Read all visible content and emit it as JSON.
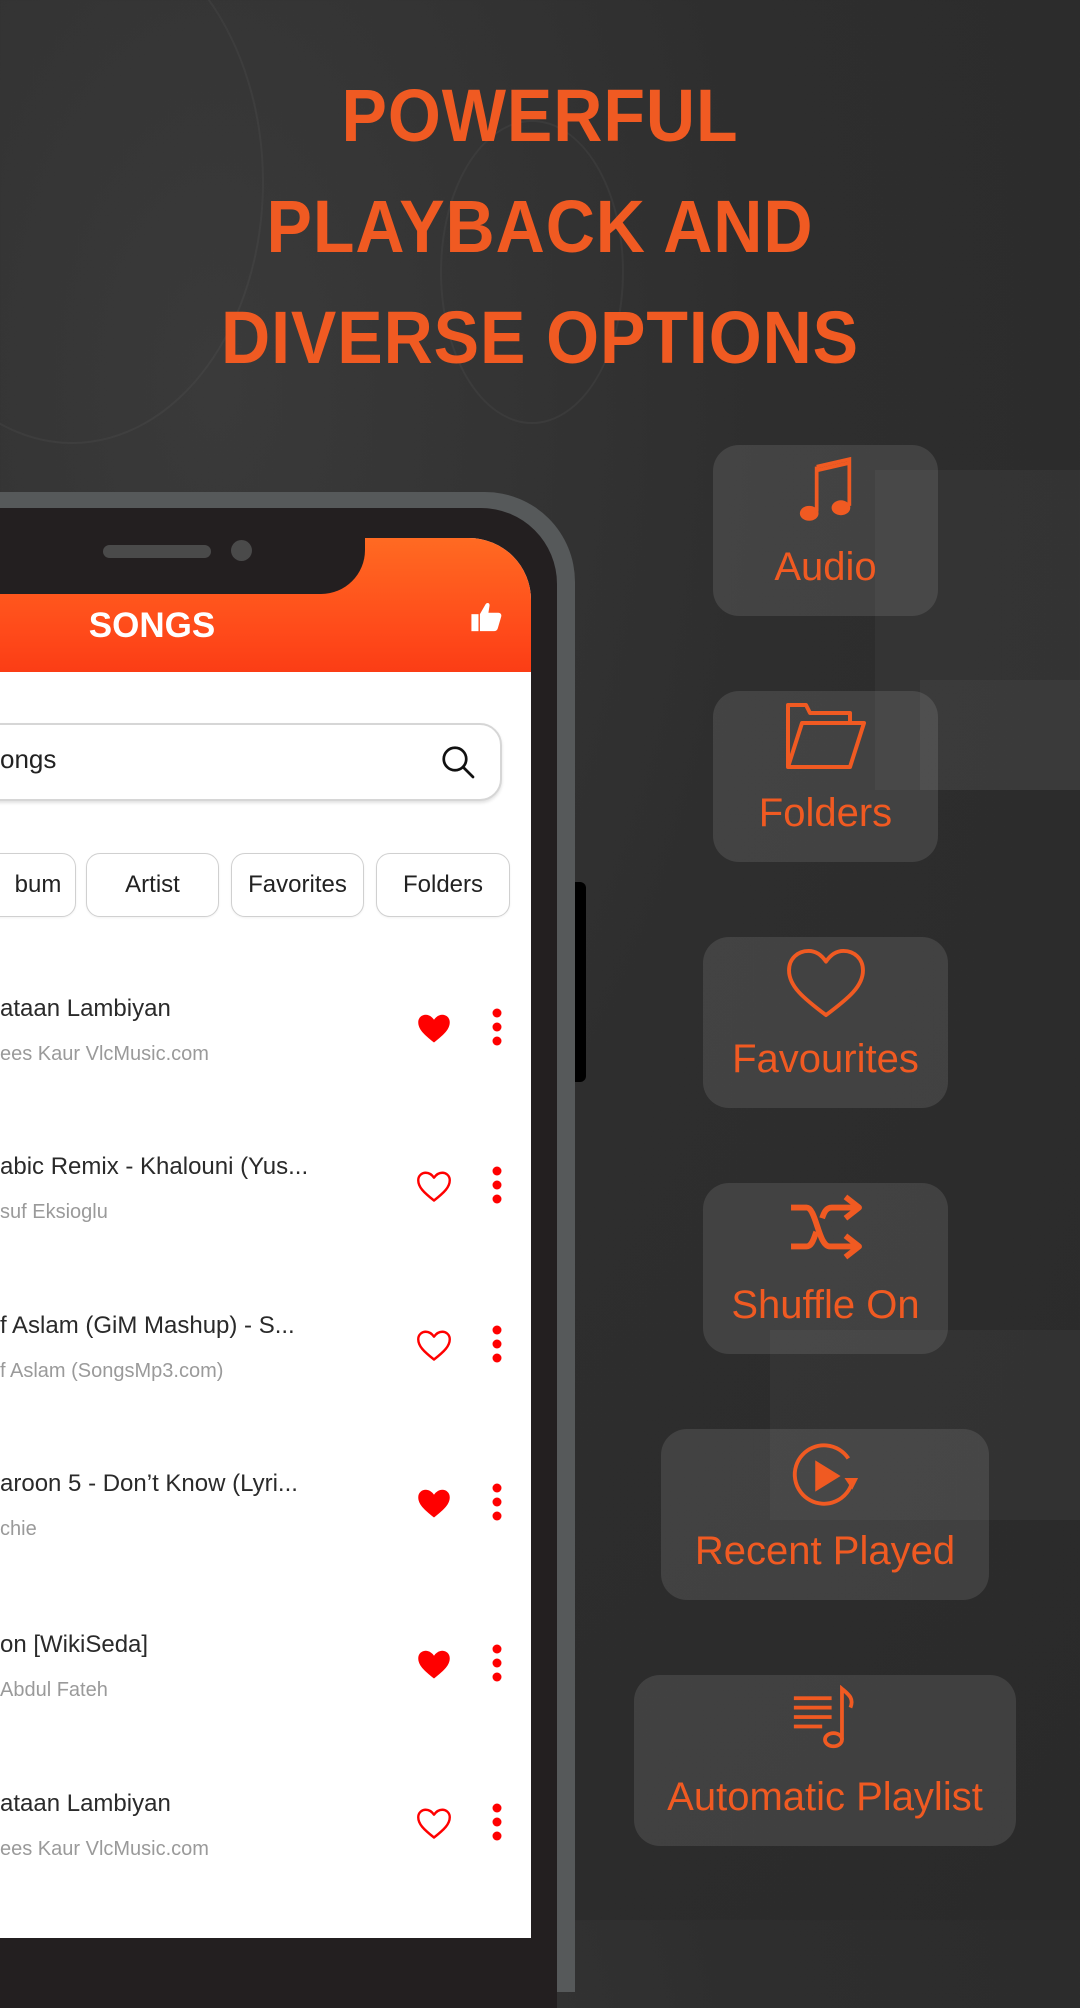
{
  "headline": {
    "lines": [
      "POWERFUL",
      "PLAYBACK AND",
      "DIVERSE OPTIONS"
    ],
    "color": "#f05a22"
  },
  "app": {
    "header_title": "SONGS",
    "header_icon": "thumbs-up-icon",
    "accent_color": "#ff4a1a",
    "search": {
      "value": "ongs",
      "icon": "search-icon"
    },
    "tabs": [
      {
        "label": "bum"
      },
      {
        "label": "Artist"
      },
      {
        "label": "Favorites"
      },
      {
        "label": "Folders"
      }
    ],
    "songs": [
      {
        "title": "ataan Lambiyan",
        "artist": "ees Kaur VlcMusic.com",
        "favorite": true
      },
      {
        "title": "abic Remix - Khalouni (Yus...",
        "artist": "suf Eksioglu",
        "favorite": false
      },
      {
        "title": "f Aslam (GiM Mashup) - S...",
        "artist": "f Aslam (SongsMp3.com)",
        "favorite": false
      },
      {
        "title": "aroon 5 - Don’t Know (Lyri...",
        "artist": "chie",
        "favorite": true
      },
      {
        "title": "on [WikiSeda]",
        "artist": "Abdul Fateh",
        "favorite": true
      },
      {
        "title": "ataan Lambiyan",
        "artist": "ees Kaur VlcMusic.com",
        "favorite": false
      }
    ],
    "favorite_color": "#ff0000"
  },
  "features": [
    {
      "label": "Audio",
      "icon": "music-note-icon"
    },
    {
      "label": "Folders",
      "icon": "folder-open-icon"
    },
    {
      "label": "Favourites",
      "icon": "heart-outline-icon"
    },
    {
      "label": "Shuffle On",
      "icon": "shuffle-icon"
    },
    {
      "label": "Recent Played",
      "icon": "replay-icon"
    },
    {
      "label": "Automatic Playlist",
      "icon": "playlist-music-icon"
    }
  ]
}
